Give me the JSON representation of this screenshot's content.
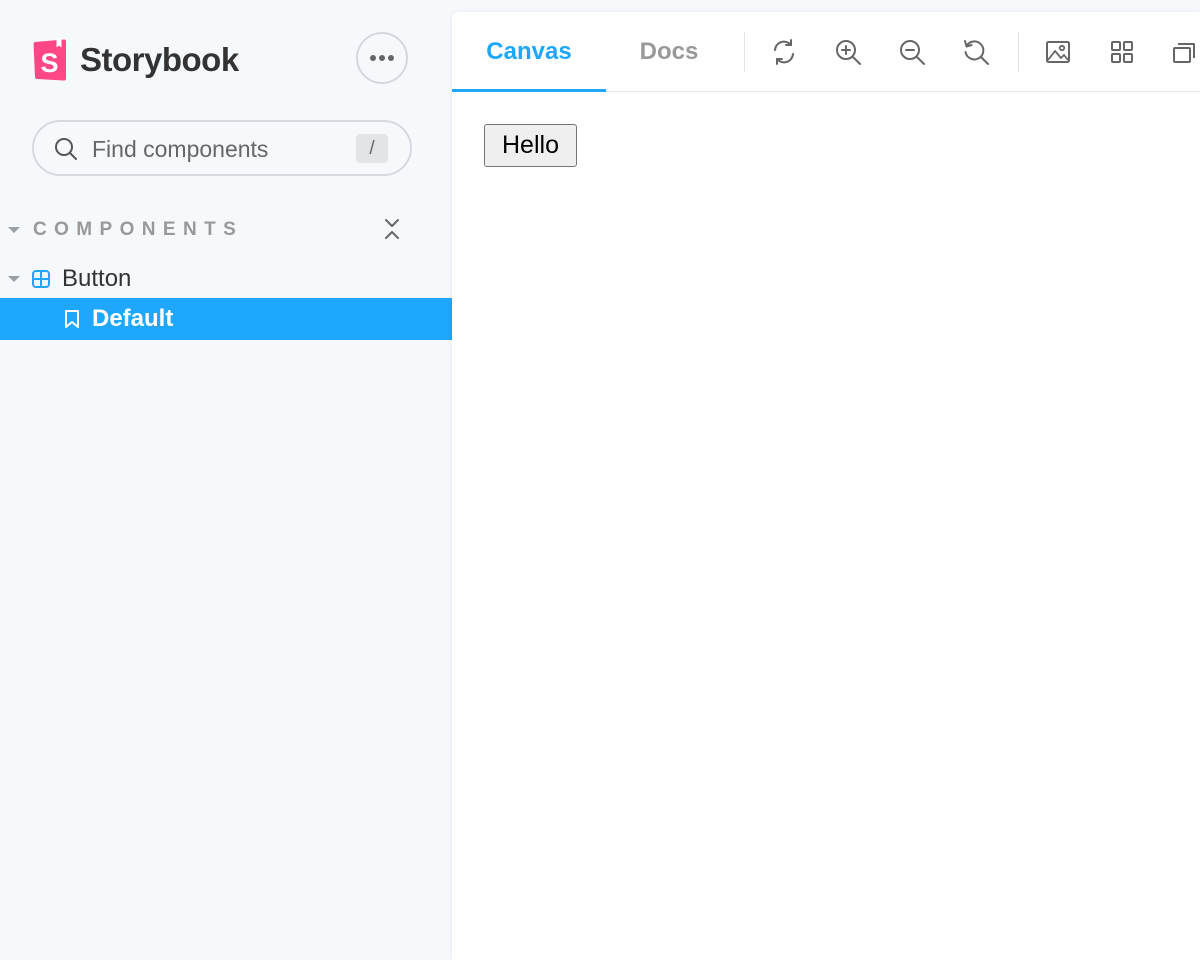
{
  "sidebar": {
    "brand_name": "Storybook",
    "search": {
      "placeholder": "Find components",
      "shortcut": "/"
    },
    "section_title": "COMPONENTS",
    "tree": {
      "component_label": "Button",
      "story_label": "Default"
    }
  },
  "toolbar": {
    "tabs": [
      {
        "label": "Canvas",
        "active": true
      },
      {
        "label": "Docs",
        "active": false
      }
    ],
    "tools": [
      "reload-icon",
      "zoom-in-icon",
      "zoom-out-icon",
      "zoom-reset-icon",
      "background-icon",
      "grid-icon",
      "outline-icon"
    ]
  },
  "preview": {
    "button_label": "Hello"
  },
  "colors": {
    "accent": "#1ea7fd",
    "brand_pink": "#ff4785",
    "sidebar_bg": "#f6f9fc",
    "text": "#333333",
    "muted": "#999999"
  }
}
